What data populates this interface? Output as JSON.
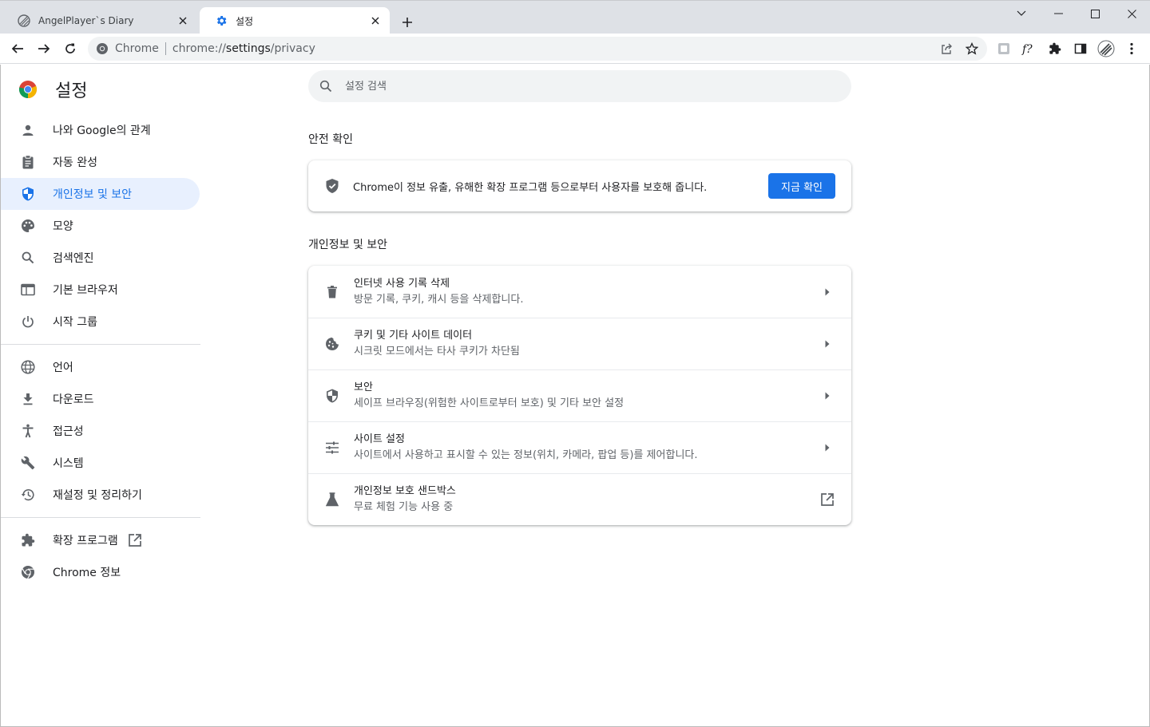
{
  "tabs": [
    {
      "title": "AngelPlayer`s Diary",
      "active": false,
      "favicon": "angelplayer-icon"
    },
    {
      "title": "설정",
      "active": true,
      "favicon": "gear-icon"
    }
  ],
  "toolbar": {
    "site_chip": "Chrome",
    "url_prefix": "chrome://",
    "url_host": "settings",
    "url_path": "/privacy"
  },
  "settings": {
    "title": "설정",
    "search_placeholder": "설정 검색"
  },
  "nav": {
    "group1": [
      {
        "label": "나와 Google의 관계",
        "icon": "person-icon"
      },
      {
        "label": "자동 완성",
        "icon": "clipboard-icon"
      },
      {
        "label": "개인정보 및 보안",
        "icon": "shield-icon",
        "selected": true
      },
      {
        "label": "모양",
        "icon": "palette-icon"
      },
      {
        "label": "검색엔진",
        "icon": "search-icon"
      },
      {
        "label": "기본 브라우저",
        "icon": "browser-window-icon"
      },
      {
        "label": "시작 그룹",
        "icon": "power-icon"
      }
    ],
    "group2": [
      {
        "label": "언어",
        "icon": "globe-icon"
      },
      {
        "label": "다운로드",
        "icon": "download-icon"
      },
      {
        "label": "접근성",
        "icon": "accessibility-icon"
      },
      {
        "label": "시스템",
        "icon": "wrench-icon"
      },
      {
        "label": "재설정 및 정리하기",
        "icon": "history-icon"
      }
    ],
    "group3": [
      {
        "label": "확장 프로그램",
        "icon": "puzzle-icon"
      },
      {
        "label": "Chrome 정보",
        "icon": "chrome-icon"
      }
    ]
  },
  "safety_check": {
    "section_title": "안전 확인",
    "text": "Chrome이 정보 유출, 유해한 확장 프로그램 등으로부터 사용자를 보호해 줍니다.",
    "button": "지금 확인"
  },
  "privacy": {
    "section_title": "개인정보 및 보안",
    "rows": [
      {
        "label": "인터넷 사용 기록 삭제",
        "sub": "방문 기록, 쿠키, 캐시 등을 삭제합니다.",
        "icon": "trash-icon"
      },
      {
        "label": "쿠키 및 기타 사이트 데이터",
        "sub": "시크릿 모드에서는 타사 쿠키가 차단됨",
        "icon": "cookie-icon"
      },
      {
        "label": "보안",
        "sub": "세이프 브라우징(위험한 사이트로부터 보호) 및 기타 보안 설정",
        "icon": "shield-icon"
      },
      {
        "label": "사이트 설정",
        "sub": "사이트에서 사용하고 표시할 수 있는 정보(위치, 카메라, 팝업 등)를 제어합니다.",
        "icon": "tune-icon"
      },
      {
        "label": "개인정보 보호 샌드박스",
        "sub": "무료 체험 기능 사용 중",
        "icon": "flask-icon"
      }
    ]
  },
  "colors": {
    "accent": "#1a73e8",
    "selected_bg": "#e8f0fe",
    "tabstrip_bg": "#dee1e6",
    "omnibox_bg": "#f1f3f4"
  }
}
